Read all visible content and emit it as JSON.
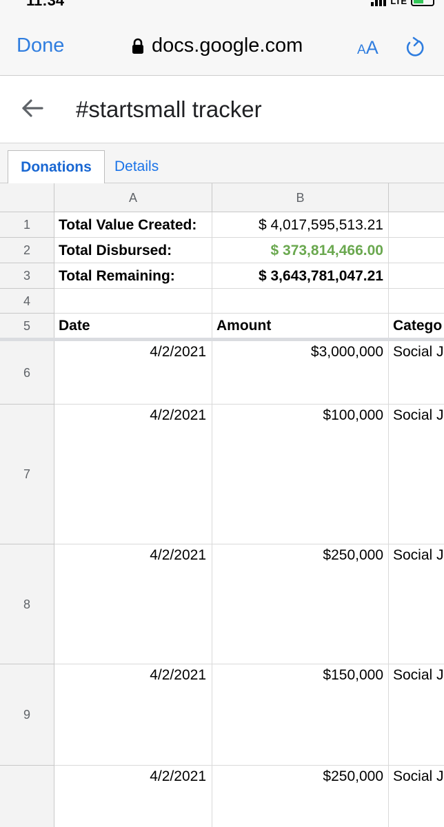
{
  "status_bar": {
    "time": "11:34",
    "network": "LTE"
  },
  "browser": {
    "done_label": "Done",
    "url": "docs.google.com",
    "text_size_label_small": "A",
    "text_size_label_large": "A"
  },
  "doc": {
    "title": "#startsmall tracker"
  },
  "tabs": [
    {
      "label": "Donations",
      "active": true
    },
    {
      "label": "Details",
      "active": false
    }
  ],
  "columns": [
    "A",
    "B"
  ],
  "summary_rows": [
    {
      "row": "1",
      "label": "Total Value Created:",
      "value": "$ 4,017,595,513.21"
    },
    {
      "row": "2",
      "label": "Total Disbursed:",
      "value": "$ 373,814,466.00"
    },
    {
      "row": "3",
      "label": "Total Remaining:",
      "value": "$ 3,643,781,047.21"
    }
  ],
  "empty_row": "4",
  "table_header": {
    "row": "5",
    "date": "Date",
    "amount": "Amount",
    "category": "Catego"
  },
  "data_rows": [
    {
      "row": "6",
      "date": "4/2/2021",
      "amount": "$3,000,000",
      "category": "Social J"
    },
    {
      "row": "7",
      "date": "4/2/2021",
      "amount": "$100,000",
      "category": "Social J"
    },
    {
      "row": "8",
      "date": "4/2/2021",
      "amount": "$250,000",
      "category": "Social J"
    },
    {
      "row": "9",
      "date": "4/2/2021",
      "amount": "$150,000",
      "category": "Social J"
    },
    {
      "row": "",
      "date": "4/2/2021",
      "amount": "$250,000",
      "category": "Social J"
    }
  ],
  "colors": {
    "accent": "#2f7ddf",
    "disbursed_green": "#6aa84f"
  }
}
